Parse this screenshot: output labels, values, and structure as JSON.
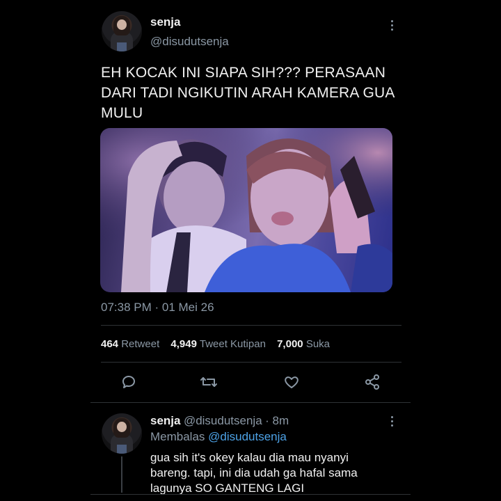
{
  "tweet": {
    "author_name": "senja",
    "author_handle": "@disudutsenja",
    "text": "EH KOCAK INI SIAPA SIH??? PERASAAN DARI TADI NGIKUTIN ARAH KAMERA GUA MULU",
    "timestamp": "07:38 PM · 01 Mei 26",
    "stats": {
      "retweets_count": "464",
      "retweets_label": "Retweet",
      "quotes_count": "4,949",
      "quotes_label": "Tweet Kutipan",
      "likes_count": "7,000",
      "likes_label": "Suka"
    },
    "actions": [
      "reply-icon",
      "retweet-icon",
      "like-icon",
      "share-icon"
    ]
  },
  "reply": {
    "author_name": "senja",
    "author_handle": "@disudutsenja",
    "time": "· 8m",
    "replying_prefix": "Membalas",
    "replying_to": "@disudutsenja",
    "lines": [
      "gua sih it's okey kalau dia mau nyanyi",
      "bareng. tapi, ini dia udah ga hafal sama",
      "lagunya SO GANTENG LAGI"
    ]
  },
  "colors": {
    "background": "#000000",
    "text": "#e7e9ea",
    "muted": "#8b98a5",
    "link": "#4da2e6",
    "divider": "#2f3336"
  }
}
